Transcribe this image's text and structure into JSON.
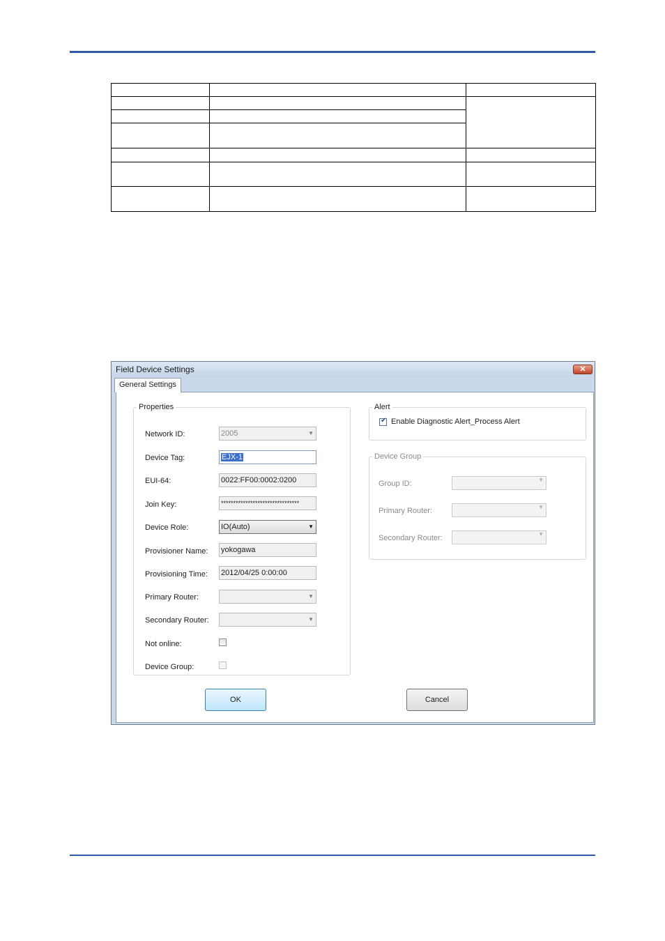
{
  "dialog": {
    "title": "Field Device Settings",
    "close_symbol": "✕",
    "tab_label": "General Settings",
    "properties": {
      "legend": "Properties",
      "network_id": {
        "label": "Network ID:",
        "value": "2005"
      },
      "device_tag": {
        "label": "Device Tag:",
        "value": "EJX-1"
      },
      "eui64": {
        "label": "EUI-64:",
        "value": "0022:FF00:0002:0200"
      },
      "join_key": {
        "label": "Join Key:",
        "value": "********************************"
      },
      "device_role": {
        "label": "Device Role:",
        "value": "IO(Auto)"
      },
      "provisioner_name": {
        "label": "Provisioner Name:",
        "value": "yokogawa"
      },
      "provisioning_time": {
        "label": "Provisioning Time:",
        "value": "2012/04/25 0:00:00"
      },
      "primary_router": {
        "label": "Primary Router:",
        "value": ""
      },
      "secondary_router": {
        "label": "Secondary Router:",
        "value": ""
      },
      "not_online": {
        "label": "Not online:",
        "checked": false
      },
      "device_group": {
        "label": "Device Group:",
        "checked": false
      }
    },
    "alert": {
      "legend": "Alert",
      "checkbox_label": "Enable Diagnostic Alert_Process Alert",
      "checked": true
    },
    "device_group_box": {
      "legend": "Device Group",
      "group_id_label": "Group ID:",
      "primary_router_label": "Primary Router:",
      "secondary_router_label": "Secondary Router:"
    },
    "buttons": {
      "ok": "OK",
      "cancel": "Cancel"
    }
  },
  "colors": {
    "accent_rule": "#2e5aa8",
    "titlebar": "#c6d6e9",
    "selection": "#3b6fc9"
  },
  "icons": [
    "close-icon",
    "dropdown-arrow-icon",
    "checkmark-icon"
  ]
}
